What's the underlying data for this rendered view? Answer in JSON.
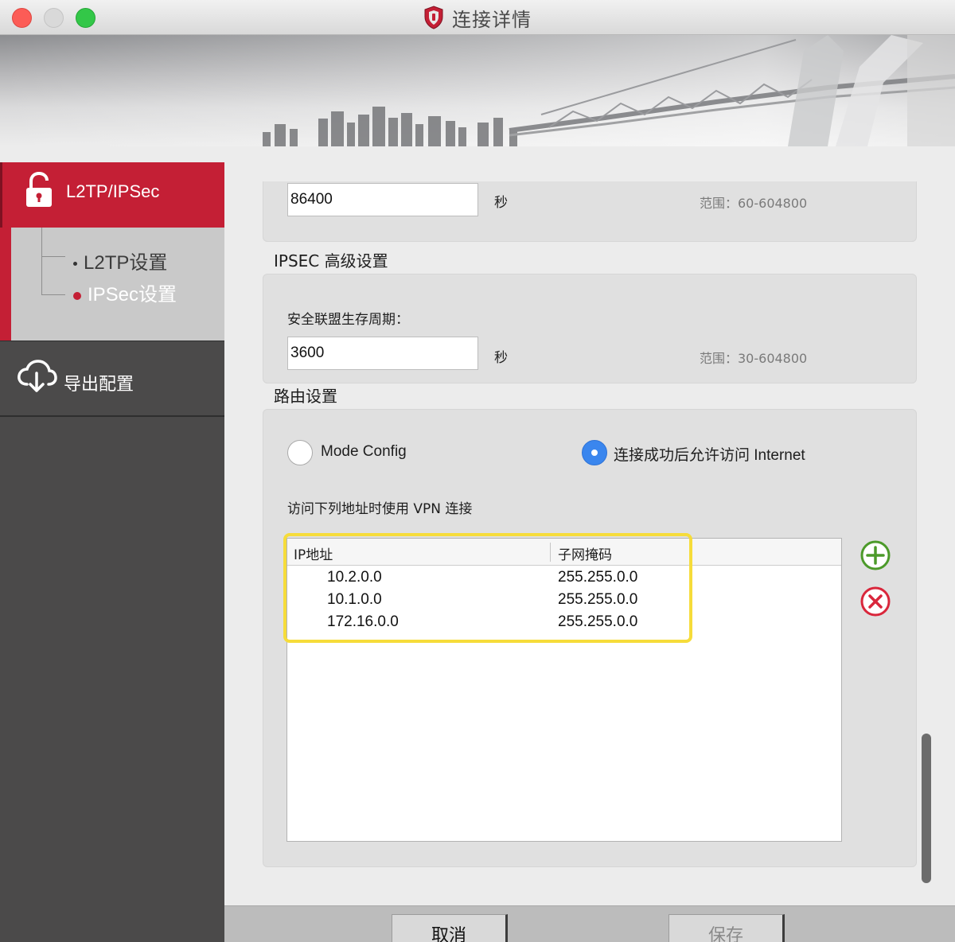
{
  "window": {
    "title": "连接详情"
  },
  "sidebar": {
    "main_item": {
      "label": "L2TP/IPSec",
      "icon": "unlocked-padlock-icon"
    },
    "sub_items": [
      {
        "label": "L2TP设置",
        "selected": false
      },
      {
        "label": "IPSec设置",
        "selected": true
      }
    ],
    "export": {
      "label": "导出配置",
      "icon": "cloud-download-icon"
    }
  },
  "top_panel": {
    "lifetime_value": "86400",
    "unit": "秒",
    "range": "范围：60-604800"
  },
  "ipsec_advanced": {
    "section_title": "IPSEC 高级设置",
    "sa_label": "安全联盟生存周期：",
    "sa_value": "3600",
    "unit": "秒",
    "range": "范围：30-604800"
  },
  "routing": {
    "section_title": "路由设置",
    "options": [
      {
        "label": "Mode Config",
        "selected": false
      },
      {
        "label": "连接成功后允许访问 Internet",
        "selected": true
      }
    ],
    "list_label": "访问下列地址时使用 VPN 连接",
    "table": {
      "columns": [
        "IP地址",
        "子网掩码"
      ],
      "rows": [
        {
          "ip": "10.2.0.0",
          "mask": "255.255.0.0"
        },
        {
          "ip": "10.1.0.0",
          "mask": "255.255.0.0"
        },
        {
          "ip": "172.16.0.0",
          "mask": "255.255.0.0"
        }
      ]
    },
    "add_icon": "plus-circle-icon",
    "delete_icon": "x-circle-icon"
  },
  "footer": {
    "cancel_label": "取消",
    "save_label": "保存"
  },
  "colors": {
    "brand_red": "#c41f35",
    "sidebar_dark": "#4b4a4a",
    "radio_blue": "#3a86ee",
    "add_green": "#4c9a2a",
    "delete_red": "#d9263b",
    "highlight_yellow": "#f6dc3a"
  }
}
